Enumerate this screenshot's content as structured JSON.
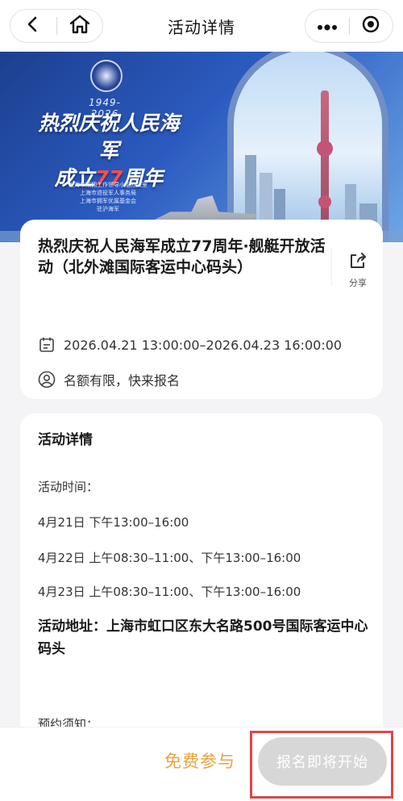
{
  "nav": {
    "title": "活动详情",
    "back_icon": "chevron-left-icon",
    "home_icon": "home-icon",
    "more_icon": "more-dots-icon",
    "close_icon": "circle-dot-icon"
  },
  "banner": {
    "years": "1949-2026",
    "headline_line1": "热烈庆祝人民海军",
    "headline_line2_pre": "成立",
    "headline_line2_num": "77",
    "headline_line2_post": "周年",
    "orgs": [
      "上海市双拥工作领导小组办公室",
      "上海市退役军人事务局",
      "上海市拥军优属基金会",
      "驻沪海军"
    ]
  },
  "event": {
    "title": "热烈庆祝人民海军成立77周年·舰艇开放活动（北外滩国际客运中心码头）",
    "share_label": "分享",
    "datetime": "2026.04.21 13:00:00–2026.04.23 16:00:00",
    "quota": "名额有限，快来报名"
  },
  "details": {
    "heading": "活动详情",
    "time_label": "活动时间：",
    "schedule": [
      "4月21日  下午13:00–16:00",
      "4月22日  上午08:30–11:00、下午13:00–16:00",
      "4月23日  上午08:30–11:00、下午13:00–16:00"
    ],
    "address": "活动地址：上海市虹口区东大名路500号国际客运中心码头",
    "notice_label": "预约须知："
  },
  "bottom": {
    "free_label": "免费参与",
    "signup_button": "报名即将开始"
  },
  "colors": {
    "accent_free": "#e8a33d",
    "button_disabled": "#d7d7d7",
    "highlight_frame": "#e04545"
  }
}
